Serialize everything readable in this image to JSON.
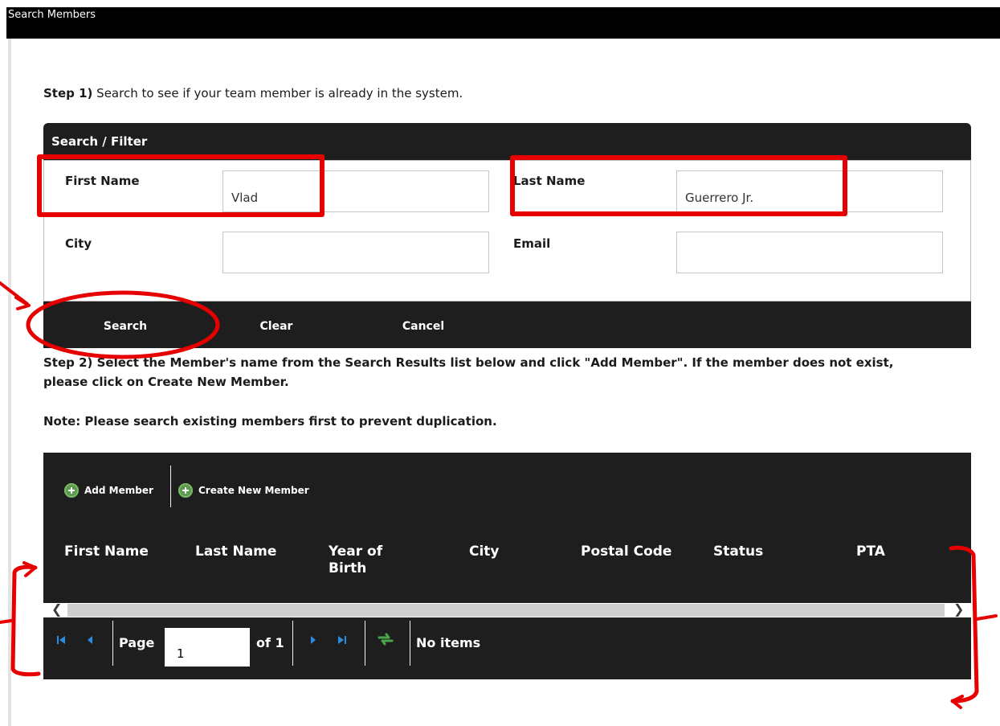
{
  "window": {
    "title": "Search Members"
  },
  "step1": {
    "bold": "Step 1)",
    "text": " Search to see if your team member is already in the system."
  },
  "search_panel": {
    "header": "Search / Filter",
    "fields": {
      "first_name": {
        "label": "First Name",
        "value": "Vlad"
      },
      "last_name": {
        "label": "Last Name",
        "value": "Guerrero Jr."
      },
      "city": {
        "label": "City",
        "value": ""
      },
      "email": {
        "label": "Email",
        "value": ""
      }
    },
    "buttons": {
      "search": "Search",
      "clear": "Clear",
      "cancel": "Cancel"
    }
  },
  "step2": {
    "line1": "Step 2) Select the Member's name from the Search Results list below and click \"Add Member\". If the member does not exist,",
    "line2": "please click on Create New Member.",
    "note": "Note: Please search existing members first to prevent duplication."
  },
  "grid": {
    "toolbar": {
      "add_member": "Add Member",
      "create_new_member": "Create New Member"
    },
    "columns": {
      "first_name": "First Name",
      "last_name": "Last Name",
      "year_of_birth_1": "Year of",
      "year_of_birth_2": "Birth",
      "city": "City",
      "postal_code": "Postal Code",
      "status": "Status",
      "pta": "PTA"
    },
    "pager": {
      "page_label": "Page",
      "page_value": "1",
      "of_label": "of 1",
      "status": "No items"
    }
  },
  "icons": [
    "plus-circle-icon",
    "first-page-icon",
    "prev-page-icon",
    "next-page-icon",
    "last-page-icon",
    "refresh-icon",
    "scroll-left-icon",
    "scroll-right-icon"
  ],
  "colors": {
    "bar": "#1e1e1e",
    "annotation": "#e60000",
    "add_icon": "#5a9a4a"
  }
}
